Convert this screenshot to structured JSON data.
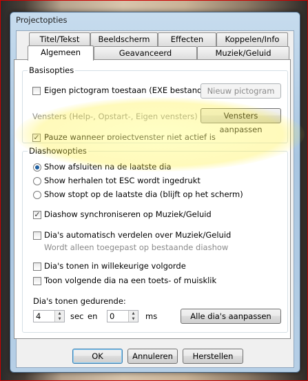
{
  "window": {
    "title": "Projectopties"
  },
  "tabs_row1": [
    "Titel/Tekst",
    "Beeldscherm",
    "Effecten",
    "Koppelen/Info"
  ],
  "tabs_row2": [
    "Algemeen",
    "Geavanceerd",
    "Muziek/Geluid"
  ],
  "basis": {
    "legend": "Basisopties",
    "own_icon_label": "Eigen pictogram toestaan (EXE bestand)",
    "new_icon_button": "Nieuw pictogram",
    "windows_label": "Vensters (Help-, Opstart-, Eigen vensters)",
    "windows_button": "Vensters aanpassen",
    "pause_label": "Pauze wanneer projectvenster niet actief is"
  },
  "slideshow": {
    "legend": "Diashowopties",
    "radio_close": "Show afsluiten na de laatste dia",
    "radio_repeat": "Show herhalen tot ESC wordt ingedrukt",
    "radio_stop": "Show stopt op de laatste dia (blijft op het scherm)",
    "sync_label": "Diashow synchroniseren op Muziek/Geluid",
    "auto_label": "Dia's automatisch verdelen over Muziek/Geluid",
    "auto_note": "Wordt alleen toegepast op bestaande diashow",
    "random_label": "Dia's tonen in willekeurige volgorde",
    "next_label": "Toon volgende dia na een toets- of muisklik",
    "duration_label": "Dia's tonen gedurende:",
    "sec_value": "4",
    "sec_unit": "sec",
    "and_label": "en",
    "ms_value": "0",
    "ms_unit": "ms",
    "adjust_all_button": "Alle dia's aanpassen"
  },
  "footer": {
    "ok": "OK",
    "cancel": "Annuleren",
    "reset": "Herstellen"
  },
  "checked": {
    "own_icon": false,
    "pause": true,
    "sync": true,
    "auto": false,
    "random": false,
    "next": false
  },
  "colors": {
    "accent": "#1e5fa0",
    "highlight": "#fff04a",
    "border_red": "#cc0000"
  }
}
